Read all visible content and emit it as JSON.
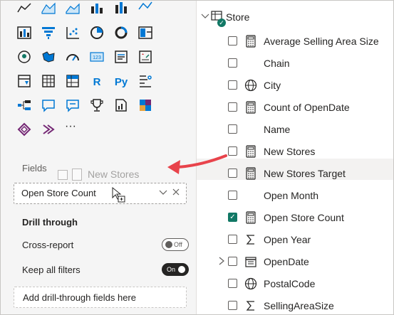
{
  "visualizations": {
    "rows": [
      [
        "area-chart-icon",
        "line-area-chart-icon",
        "stacked-area-icon",
        "ribbon-chart-icon",
        "waterfall-chart-icon",
        "line-stacked-icon"
      ],
      [
        "matrix-chart-icon",
        "funnel-icon",
        "scatter-chart-icon",
        "pie-chart-icon",
        "donut-chart-icon",
        "treemap-icon"
      ],
      [
        "map-icon",
        "filled-map-icon",
        "gauge-icon",
        "card-icon",
        "multi-row-card-icon",
        "kpi-icon"
      ],
      [
        "slicer-icon",
        "table-icon",
        "matrix-icon",
        "r-script-icon",
        "python-icon",
        "key-influencers-icon"
      ],
      [
        "decomposition-tree-icon",
        "qa-icon",
        "smart-narrative-icon",
        "goals-icon",
        "paginated-report-icon",
        "power-apps-icon"
      ],
      [
        "power-automate-icon",
        "more-visuals-icon",
        "ellipsis-icon"
      ]
    ],
    "r_label": "R",
    "py_label": "Py",
    "ellipsis": "···"
  },
  "fields_section": {
    "label": "Fields",
    "well_value": "Open Store Count",
    "drag_ghost_label": "New Stores"
  },
  "drill_through": {
    "title": "Drill through",
    "cross_report_label": "Cross-report",
    "cross_report_state": "Off",
    "keep_filters_label": "Keep all filters",
    "keep_filters_state": "On",
    "add_fields_placeholder": "Add drill-through fields here"
  },
  "data_pane": {
    "table_name": "Store",
    "fields": [
      {
        "label": "Average Selling Area Size",
        "icon": "calculator-icon",
        "checked": false,
        "expandable": false
      },
      {
        "label": "Chain",
        "icon": "none",
        "checked": false,
        "expandable": false
      },
      {
        "label": "City",
        "icon": "globe-icon",
        "checked": false,
        "expandable": false
      },
      {
        "label": "Count of OpenDate",
        "icon": "calculator-icon",
        "checked": false,
        "expandable": false
      },
      {
        "label": "Name",
        "icon": "none",
        "checked": false,
        "expandable": false
      },
      {
        "label": "New Stores",
        "icon": "calculator-icon",
        "checked": false,
        "expandable": false
      },
      {
        "label": "New Stores Target",
        "icon": "calculator-icon",
        "checked": false,
        "expandable": false
      },
      {
        "label": "Open Month",
        "icon": "none",
        "checked": false,
        "expandable": false
      },
      {
        "label": "Open Store Count",
        "icon": "calculator-icon",
        "checked": true,
        "expandable": false
      },
      {
        "label": "Open Year",
        "icon": "sigma-icon",
        "checked": false,
        "expandable": false
      },
      {
        "label": "OpenDate",
        "icon": "calendar-icon",
        "checked": false,
        "expandable": true
      },
      {
        "label": "PostalCode",
        "icon": "globe-icon",
        "checked": false,
        "expandable": false
      },
      {
        "label": "SellingAreaSize",
        "icon": "sigma-icon",
        "checked": false,
        "expandable": false
      }
    ]
  },
  "colors": {
    "accent": "#117865",
    "annotation_arrow": "#e8434b",
    "viz_blue": "#0078d4"
  }
}
